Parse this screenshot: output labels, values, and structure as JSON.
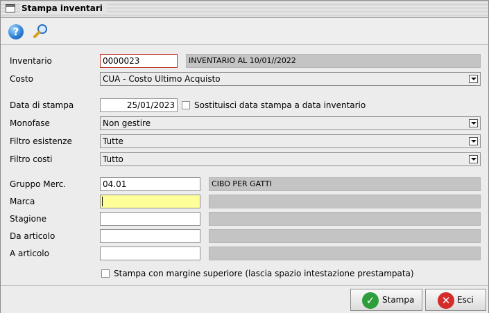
{
  "window": {
    "title": "Stampa inventari"
  },
  "toolbar": {
    "help_icon": "help-icon",
    "search_icon": "search-icon"
  },
  "form": {
    "inventario": {
      "label": "Inventario",
      "value": "0000023",
      "description": "INVENTARIO AL 10/01//2022"
    },
    "costo": {
      "label": "Costo",
      "value": "CUA - Costo Ultimo Acquisto"
    },
    "data_stampa": {
      "label": "Data di stampa",
      "value": "25/01/2023",
      "checkbox_label": "Sostituisci data stampa a data inventario",
      "checked": false
    },
    "monofase": {
      "label": "Monofase",
      "value": "Non gestire"
    },
    "filtro_esistenze": {
      "label": "Filtro esistenze",
      "value": "Tutte"
    },
    "filtro_costi": {
      "label": "Filtro costi",
      "value": "Tutto"
    },
    "gruppo_merc": {
      "label": "Gruppo Merc.",
      "value": "04.01",
      "description": "CIBO PER GATTI"
    },
    "marca": {
      "label": "Marca",
      "value": "",
      "description": ""
    },
    "stagione": {
      "label": "Stagione",
      "value": "",
      "description": ""
    },
    "da_articolo": {
      "label": "Da articolo",
      "value": "",
      "description": ""
    },
    "a_articolo": {
      "label": "A articolo",
      "value": "",
      "description": ""
    },
    "margine": {
      "label": "Stampa con margine superiore (lascia spazio intestazione prestampata)",
      "checked": false
    }
  },
  "buttons": {
    "stampa": "Stampa",
    "esci": "Esci"
  },
  "colors": {
    "active_field_bg": "#ffff99",
    "invalid_border": "#c0392b",
    "stampa_icon": "#2e9e3a",
    "esci_icon": "#d42b2b"
  }
}
